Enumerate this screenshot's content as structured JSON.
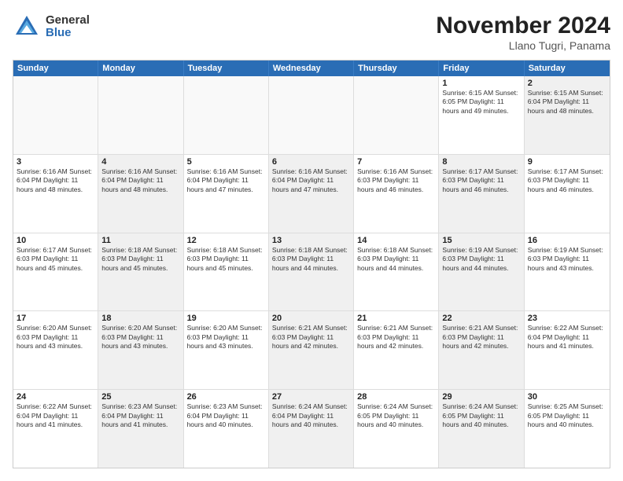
{
  "header": {
    "logo_general": "General",
    "logo_blue": "Blue",
    "main_title": "November 2024",
    "subtitle": "Llano Tugri, Panama"
  },
  "days": [
    "Sunday",
    "Monday",
    "Tuesday",
    "Wednesday",
    "Thursday",
    "Friday",
    "Saturday"
  ],
  "rows": [
    [
      {
        "day": "",
        "text": "",
        "shaded": false,
        "empty": true
      },
      {
        "day": "",
        "text": "",
        "shaded": false,
        "empty": true
      },
      {
        "day": "",
        "text": "",
        "shaded": false,
        "empty": true
      },
      {
        "day": "",
        "text": "",
        "shaded": false,
        "empty": true
      },
      {
        "day": "",
        "text": "",
        "shaded": false,
        "empty": true
      },
      {
        "day": "1",
        "text": "Sunrise: 6:15 AM\nSunset: 6:05 PM\nDaylight: 11 hours and 49 minutes.",
        "shaded": false,
        "empty": false
      },
      {
        "day": "2",
        "text": "Sunrise: 6:15 AM\nSunset: 6:04 PM\nDaylight: 11 hours and 48 minutes.",
        "shaded": true,
        "empty": false
      }
    ],
    [
      {
        "day": "3",
        "text": "Sunrise: 6:16 AM\nSunset: 6:04 PM\nDaylight: 11 hours and 48 minutes.",
        "shaded": false,
        "empty": false
      },
      {
        "day": "4",
        "text": "Sunrise: 6:16 AM\nSunset: 6:04 PM\nDaylight: 11 hours and 48 minutes.",
        "shaded": true,
        "empty": false
      },
      {
        "day": "5",
        "text": "Sunrise: 6:16 AM\nSunset: 6:04 PM\nDaylight: 11 hours and 47 minutes.",
        "shaded": false,
        "empty": false
      },
      {
        "day": "6",
        "text": "Sunrise: 6:16 AM\nSunset: 6:04 PM\nDaylight: 11 hours and 47 minutes.",
        "shaded": true,
        "empty": false
      },
      {
        "day": "7",
        "text": "Sunrise: 6:16 AM\nSunset: 6:03 PM\nDaylight: 11 hours and 46 minutes.",
        "shaded": false,
        "empty": false
      },
      {
        "day": "8",
        "text": "Sunrise: 6:17 AM\nSunset: 6:03 PM\nDaylight: 11 hours and 46 minutes.",
        "shaded": true,
        "empty": false
      },
      {
        "day": "9",
        "text": "Sunrise: 6:17 AM\nSunset: 6:03 PM\nDaylight: 11 hours and 46 minutes.",
        "shaded": false,
        "empty": false
      }
    ],
    [
      {
        "day": "10",
        "text": "Sunrise: 6:17 AM\nSunset: 6:03 PM\nDaylight: 11 hours and 45 minutes.",
        "shaded": false,
        "empty": false
      },
      {
        "day": "11",
        "text": "Sunrise: 6:18 AM\nSunset: 6:03 PM\nDaylight: 11 hours and 45 minutes.",
        "shaded": true,
        "empty": false
      },
      {
        "day": "12",
        "text": "Sunrise: 6:18 AM\nSunset: 6:03 PM\nDaylight: 11 hours and 45 minutes.",
        "shaded": false,
        "empty": false
      },
      {
        "day": "13",
        "text": "Sunrise: 6:18 AM\nSunset: 6:03 PM\nDaylight: 11 hours and 44 minutes.",
        "shaded": true,
        "empty": false
      },
      {
        "day": "14",
        "text": "Sunrise: 6:18 AM\nSunset: 6:03 PM\nDaylight: 11 hours and 44 minutes.",
        "shaded": false,
        "empty": false
      },
      {
        "day": "15",
        "text": "Sunrise: 6:19 AM\nSunset: 6:03 PM\nDaylight: 11 hours and 44 minutes.",
        "shaded": true,
        "empty": false
      },
      {
        "day": "16",
        "text": "Sunrise: 6:19 AM\nSunset: 6:03 PM\nDaylight: 11 hours and 43 minutes.",
        "shaded": false,
        "empty": false
      }
    ],
    [
      {
        "day": "17",
        "text": "Sunrise: 6:20 AM\nSunset: 6:03 PM\nDaylight: 11 hours and 43 minutes.",
        "shaded": false,
        "empty": false
      },
      {
        "day": "18",
        "text": "Sunrise: 6:20 AM\nSunset: 6:03 PM\nDaylight: 11 hours and 43 minutes.",
        "shaded": true,
        "empty": false
      },
      {
        "day": "19",
        "text": "Sunrise: 6:20 AM\nSunset: 6:03 PM\nDaylight: 11 hours and 43 minutes.",
        "shaded": false,
        "empty": false
      },
      {
        "day": "20",
        "text": "Sunrise: 6:21 AM\nSunset: 6:03 PM\nDaylight: 11 hours and 42 minutes.",
        "shaded": true,
        "empty": false
      },
      {
        "day": "21",
        "text": "Sunrise: 6:21 AM\nSunset: 6:03 PM\nDaylight: 11 hours and 42 minutes.",
        "shaded": false,
        "empty": false
      },
      {
        "day": "22",
        "text": "Sunrise: 6:21 AM\nSunset: 6:03 PM\nDaylight: 11 hours and 42 minutes.",
        "shaded": true,
        "empty": false
      },
      {
        "day": "23",
        "text": "Sunrise: 6:22 AM\nSunset: 6:04 PM\nDaylight: 11 hours and 41 minutes.",
        "shaded": false,
        "empty": false
      }
    ],
    [
      {
        "day": "24",
        "text": "Sunrise: 6:22 AM\nSunset: 6:04 PM\nDaylight: 11 hours and 41 minutes.",
        "shaded": false,
        "empty": false
      },
      {
        "day": "25",
        "text": "Sunrise: 6:23 AM\nSunset: 6:04 PM\nDaylight: 11 hours and 41 minutes.",
        "shaded": true,
        "empty": false
      },
      {
        "day": "26",
        "text": "Sunrise: 6:23 AM\nSunset: 6:04 PM\nDaylight: 11 hours and 40 minutes.",
        "shaded": false,
        "empty": false
      },
      {
        "day": "27",
        "text": "Sunrise: 6:24 AM\nSunset: 6:04 PM\nDaylight: 11 hours and 40 minutes.",
        "shaded": true,
        "empty": false
      },
      {
        "day": "28",
        "text": "Sunrise: 6:24 AM\nSunset: 6:05 PM\nDaylight: 11 hours and 40 minutes.",
        "shaded": false,
        "empty": false
      },
      {
        "day": "29",
        "text": "Sunrise: 6:24 AM\nSunset: 6:05 PM\nDaylight: 11 hours and 40 minutes.",
        "shaded": true,
        "empty": false
      },
      {
        "day": "30",
        "text": "Sunrise: 6:25 AM\nSunset: 6:05 PM\nDaylight: 11 hours and 40 minutes.",
        "shaded": false,
        "empty": false
      }
    ]
  ]
}
